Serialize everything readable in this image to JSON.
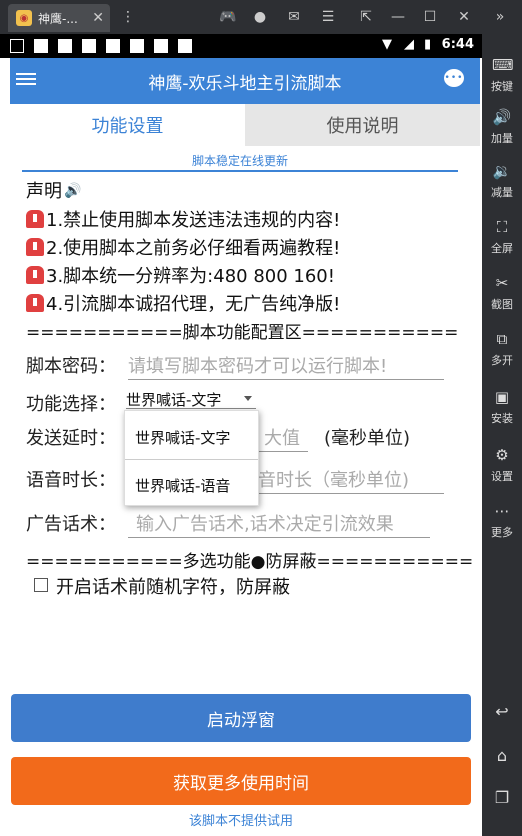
{
  "window": {
    "tab_title": "神鹰-...",
    "tab_icon": "app-icon"
  },
  "statusbar": {
    "time": "6:44"
  },
  "appbar": {
    "title": "神鹰-欢乐斗地主引流脚本"
  },
  "tabs": {
    "settings": "功能设置",
    "manual": "使用说明"
  },
  "update_notice": "脚本稳定在线更新",
  "declaration": {
    "title": "声明",
    "items": [
      "1.禁止使用脚本发送违法违规的内容!",
      "2.使用脚本之前务必仔细看两遍教程!",
      "3.脚本统一分辨率为:480  800  160!",
      "4.引流脚本诚招代理，无广告纯净版!"
    ]
  },
  "config_divider": "===========脚本功能配置区===========",
  "form": {
    "password_label": "脚本密码：",
    "password_placeholder": "请填写脚本密码才可以运行脚本!",
    "function_label": "功能选择：",
    "function_selected": "世界喊话-文字",
    "function_options": [
      "世界喊话-文字",
      "世界喊话-语音"
    ],
    "delay_label": "发送延时：",
    "delay_placeholder_visible": "大值",
    "delay_unit": "(毫秒单位)",
    "voice_label": "语音时长：",
    "voice_placeholder_visible": "音时长（毫秒单位)",
    "ad_label": "广告话术：",
    "ad_placeholder": "输入广告话术,话术决定引流效果"
  },
  "multi_divider": "===========多选功能●防屏蔽===========",
  "checkbox_label": "开启话术前随机字符，防屏蔽",
  "buttons": {
    "start_float": "启动浮窗",
    "get_time": "获取更多使用时间"
  },
  "footer": "该脚本不提供试用",
  "sidebar": {
    "items": [
      "按键",
      "加量",
      "减量",
      "全屏",
      "截图",
      "多开",
      "安装",
      "设置",
      "更多"
    ]
  }
}
